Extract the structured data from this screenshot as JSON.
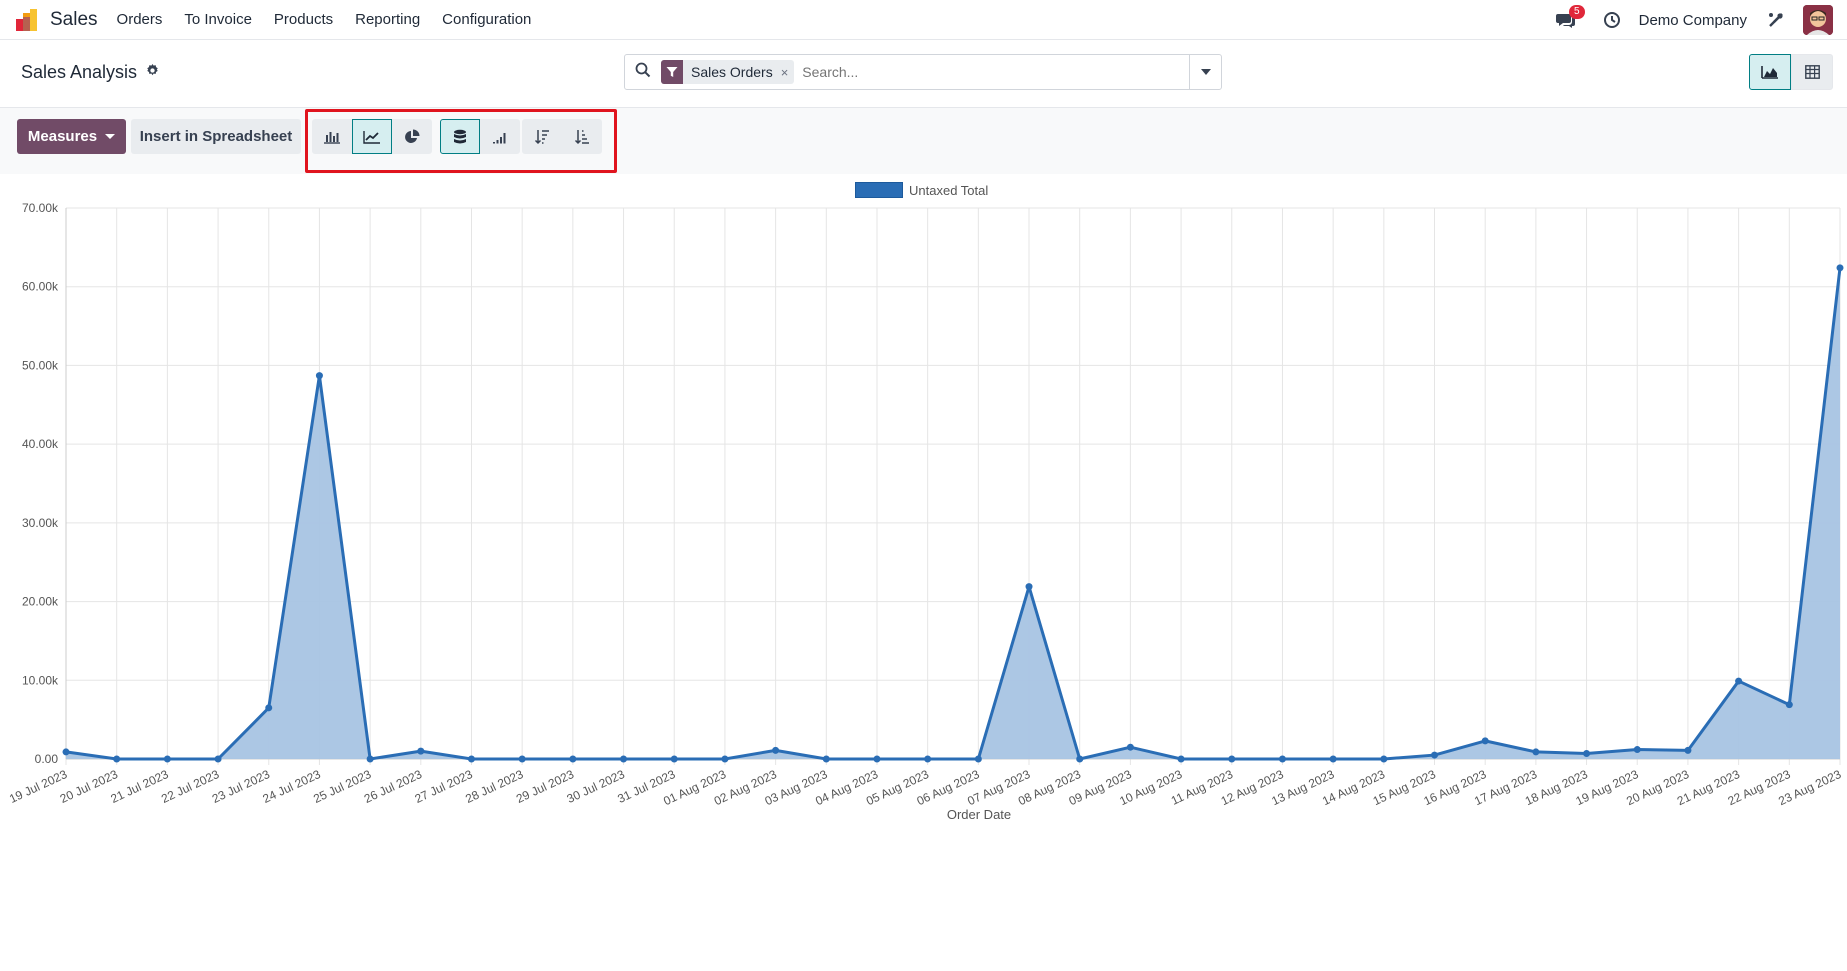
{
  "navbar": {
    "app_name": "Sales",
    "menu": [
      "Orders",
      "To Invoice",
      "Products",
      "Reporting",
      "Configuration"
    ],
    "messages_count": "5",
    "company": "Demo Company",
    "icons": [
      "sales-app-icon",
      "chat-icon",
      "clock-icon",
      "tools-icon",
      "avatar"
    ]
  },
  "control_panel": {
    "title": "Sales Analysis",
    "facet_label": "Sales Orders",
    "facet_close": "×",
    "search_placeholder": "Search...",
    "views": [
      {
        "name": "graph",
        "active": true
      },
      {
        "name": "pivot",
        "active": false
      }
    ]
  },
  "toolbar": {
    "measures_label": "Measures",
    "insert_label": "Insert in Spreadsheet",
    "chart_types": [
      {
        "name": "bar-chart-icon",
        "active": false
      },
      {
        "name": "line-chart-icon",
        "active": true
      },
      {
        "name": "pie-chart-icon",
        "active": false
      }
    ],
    "options": [
      {
        "name": "stacked-icon",
        "active": true
      },
      {
        "name": "cumulative-icon",
        "active": false
      }
    ],
    "sort": [
      {
        "name": "sort-descending-icon",
        "active": false
      },
      {
        "name": "sort-ascending-icon",
        "active": false
      }
    ],
    "accent": "#714b67",
    "highlight_color": "#e0141e"
  },
  "chart_data": {
    "type": "area",
    "legend": [
      "Untaxed Total"
    ],
    "legend_position": "top",
    "xlabel": "Order Date",
    "ylabel": "",
    "ylim": [
      0,
      70000
    ],
    "y_ticks": [
      "0.00",
      "10.00k",
      "20.00k",
      "30.00k",
      "40.00k",
      "50.00k",
      "60.00k",
      "70.00k"
    ],
    "grid": true,
    "color": "#2a6db5",
    "fill": "#a8c4e3",
    "categories": [
      "19 Jul 2023",
      "20 Jul 2023",
      "21 Jul 2023",
      "22 Jul 2023",
      "23 Jul 2023",
      "24 Jul 2023",
      "25 Jul 2023",
      "26 Jul 2023",
      "27 Jul 2023",
      "28 Jul 2023",
      "29 Jul 2023",
      "30 Jul 2023",
      "31 Jul 2023",
      "01 Aug 2023",
      "02 Aug 2023",
      "03 Aug 2023",
      "04 Aug 2023",
      "05 Aug 2023",
      "06 Aug 2023",
      "07 Aug 2023",
      "08 Aug 2023",
      "09 Aug 2023",
      "10 Aug 2023",
      "11 Aug 2023",
      "12 Aug 2023",
      "13 Aug 2023",
      "14 Aug 2023",
      "15 Aug 2023",
      "16 Aug 2023",
      "17 Aug 2023",
      "18 Aug 2023",
      "19 Aug 2023",
      "20 Aug 2023",
      "21 Aug 2023",
      "22 Aug 2023",
      "23 Aug 2023"
    ],
    "series": [
      {
        "name": "Untaxed Total",
        "values": [
          900,
          0,
          0,
          0,
          6500,
          48700,
          0,
          1000,
          0,
          0,
          0,
          0,
          0,
          0,
          1100,
          0,
          0,
          0,
          0,
          21900,
          0,
          1500,
          0,
          0,
          0,
          0,
          0,
          500,
          2300,
          900,
          700,
          1200,
          1100,
          9900,
          6900,
          62400
        ]
      }
    ]
  }
}
